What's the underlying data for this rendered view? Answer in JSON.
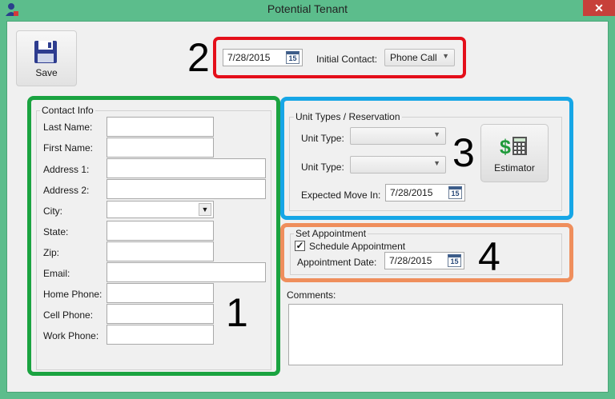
{
  "window": {
    "title": "Potential Tenant",
    "close_glyph": "✕"
  },
  "toolbar": {
    "save_label": "Save"
  },
  "header": {
    "date": "7/28/2015",
    "initial_contact_label": "Initial Contact:",
    "initial_contact_value": "Phone Call"
  },
  "callouts": {
    "one": "1",
    "two": "2",
    "three": "3",
    "four": "4"
  },
  "contact_info": {
    "title": "Contact Info",
    "fields": [
      {
        "label": "Last Name:",
        "value": ""
      },
      {
        "label": "First Name:",
        "value": ""
      },
      {
        "label": "Address 1:",
        "value": ""
      },
      {
        "label": "Address 2:",
        "value": ""
      },
      {
        "label": "City:",
        "value": ""
      },
      {
        "label": "State:",
        "value": ""
      },
      {
        "label": "Zip:",
        "value": ""
      },
      {
        "label": "Email:",
        "value": ""
      },
      {
        "label": "Home Phone:",
        "value": ""
      },
      {
        "label": "Cell Phone:",
        "value": ""
      },
      {
        "label": "Work Phone:",
        "value": ""
      }
    ]
  },
  "unit_types": {
    "title": "Unit Types / Reservation",
    "unit_type_label": "Unit Type:",
    "unit_type_1_value": "",
    "unit_type_2_value": "",
    "expected_move_in_label": "Expected Move In:",
    "expected_move_in_date": "7/28/2015",
    "estimator_label": "Estimator"
  },
  "appointment": {
    "title": "Set Appointment",
    "schedule_label": "Schedule Appointment",
    "schedule_checked": true,
    "date_label": "Appointment Date:",
    "date_value": "7/28/2015"
  },
  "comments": {
    "label": "Comments:",
    "value": ""
  },
  "calendar_icon_day": "15",
  "colors": {
    "window_frame": "#5cbd8c",
    "callout_red": "#e40f1a",
    "callout_green": "#1aa340",
    "callout_blue": "#16a6e6",
    "callout_orange": "#ef8e5c"
  }
}
